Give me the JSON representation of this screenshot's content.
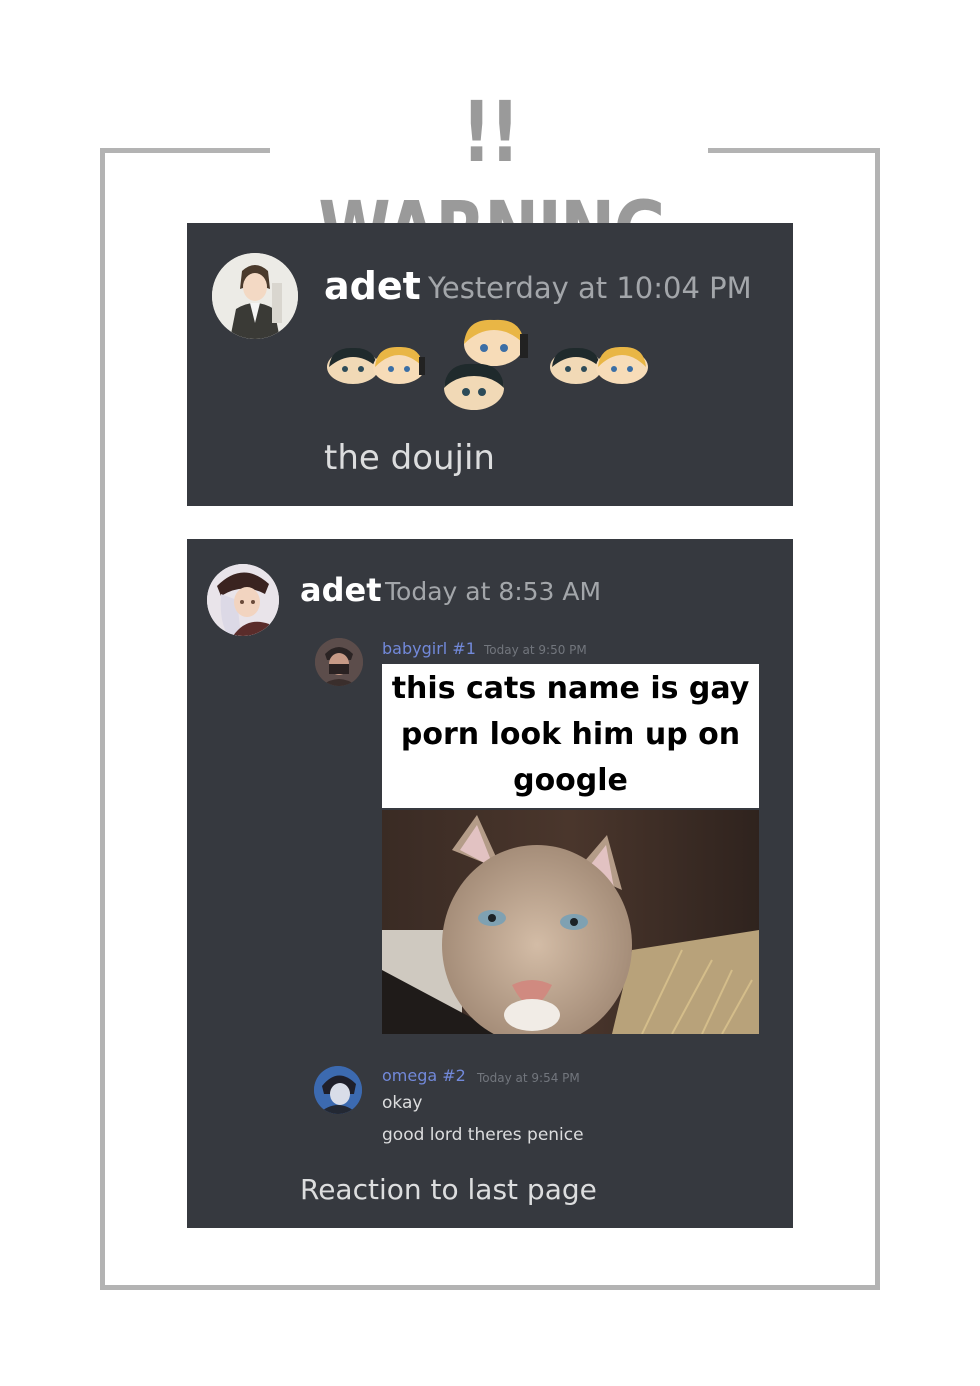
{
  "header": {
    "title": "!! WARNING !!"
  },
  "message_1": {
    "username": "adet",
    "timestamp": "Yesterday at 10:04 PM",
    "emojis": [
      "chibi-pair-emoji",
      "chibi-stack-emoji",
      "chibi-pair-emoji"
    ],
    "text": "the doujin"
  },
  "message_2": {
    "username": "adet",
    "timestamp": "Today at 8:53 AM",
    "quoted": [
      {
        "username": "babygirl #1",
        "timestamp": "Today at 9:50 PM",
        "name_color": "#7289da",
        "image_caption": [
          "this cats name is gay",
          "porn look him up on",
          "google"
        ],
        "image_subject": "cougar-photo"
      },
      {
        "username": "omega #2",
        "timestamp": "Today at 9:54 PM",
        "name_color": "#7289da",
        "lines": [
          "okay",
          "good lord theres penice"
        ]
      }
    ],
    "text": "Reaction to last page"
  },
  "colors": {
    "panel": "#36393f",
    "frame": "#b3b3b3",
    "title": "#9a9a9a",
    "link": "#7289da"
  }
}
